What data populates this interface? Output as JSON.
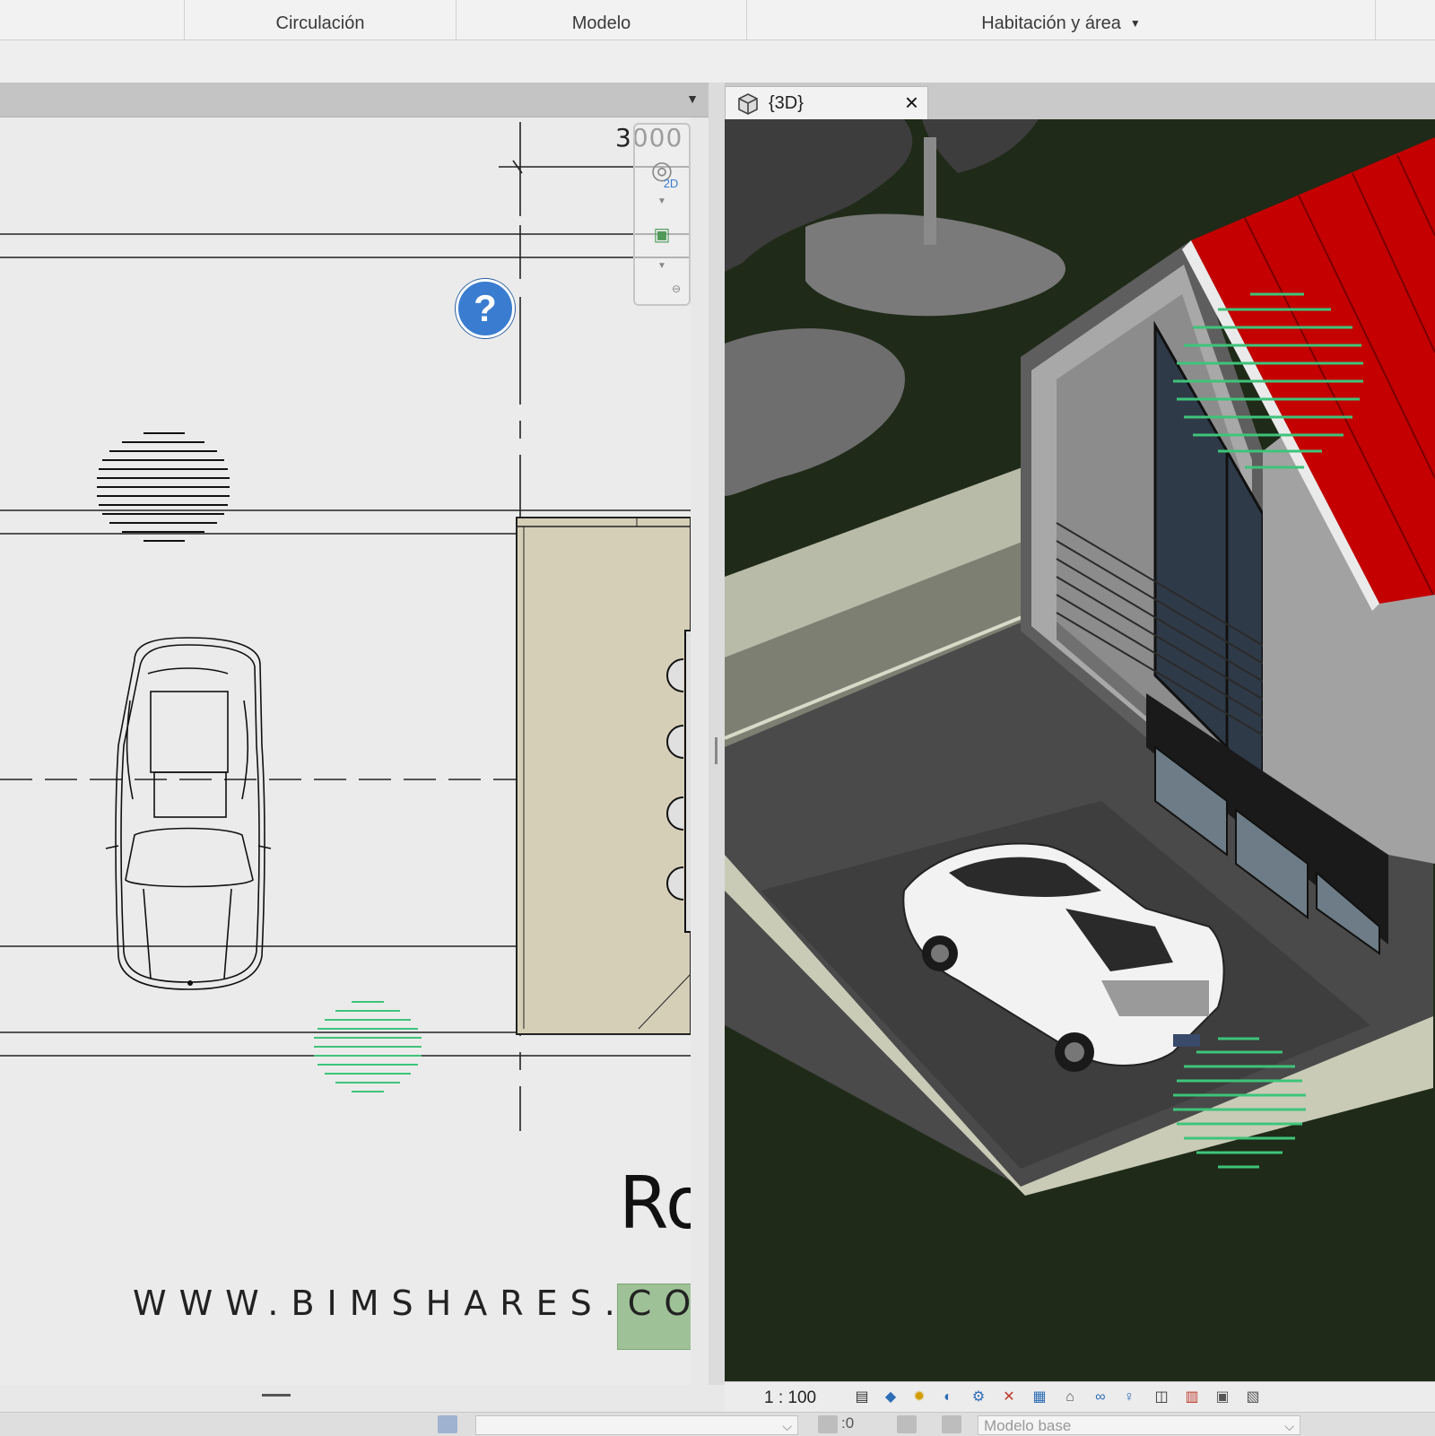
{
  "ribbon": {
    "tabs": [
      {
        "label": "Circulación"
      },
      {
        "label": "Modelo"
      },
      {
        "label": "Habitación y área",
        "has_dropdown": true
      }
    ]
  },
  "plan_view": {
    "dimension_label": "3000",
    "room_label_partial": "Ro",
    "watermark": "WWW.BIMSHARES.COM",
    "help_icon": "?",
    "nav_bar_2d_label": "2D",
    "menu_icon": "filter-caret-icon"
  },
  "view_3d": {
    "tab_label": "{3D}",
    "tab_icon": "cube-icon",
    "close_icon": "×",
    "roof_color": "#c40000",
    "ground_color": "#1f2a18"
  },
  "view_controls": {
    "scale": "1 : 100",
    "icons": [
      "detail-level-icon",
      "visual-style-icon",
      "sun-path-icon",
      "shadows-icon",
      "render-icon",
      "crop-view-icon",
      "show-crop-icon",
      "unlock-3d-icon",
      "temporary-hide-icon",
      "reveal-hidden-icon",
      "analytical-model-icon",
      "highlight-displacement-icon",
      "temporary-view-icon",
      "worksharing-icon",
      "design-options-icon",
      "constraints-icon"
    ]
  },
  "status_bar": {
    "workset_value": "",
    "editable_count": ":0",
    "design_option": "Modelo base"
  },
  "colors": {
    "highlight_hatch": "#3ec47a",
    "plan_room_fill": "#d6cfb8",
    "help_blue": "#3a7dd0"
  }
}
